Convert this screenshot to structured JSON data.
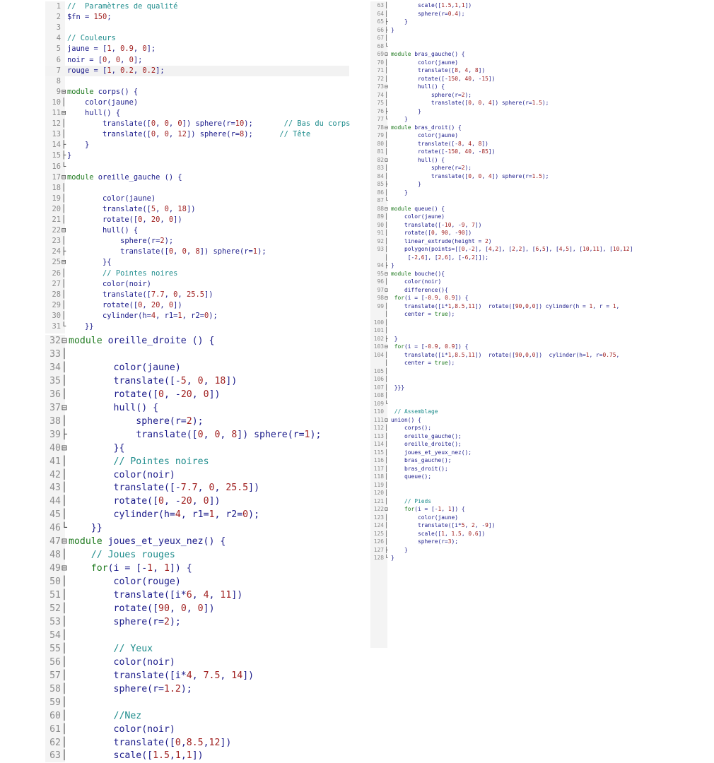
{
  "editor_left": {
    "lines": [
      {
        "n": "1",
        "f": "",
        "t": "//  Paramètres de qualité"
      },
      {
        "n": "2",
        "f": "",
        "t": "$fn = 150;"
      },
      {
        "n": "3",
        "f": "",
        "t": ""
      },
      {
        "n": "4",
        "f": "",
        "t": "// Couleurs"
      },
      {
        "n": "5",
        "f": "",
        "t": "jaune = [1, 0.9, 0];"
      },
      {
        "n": "6",
        "f": "",
        "t": "noir = [0, 0, 0];"
      },
      {
        "n": "7",
        "f": "",
        "t": "rouge = [1, 0.2, 0.2];"
      },
      {
        "n": "8",
        "f": "",
        "t": ""
      },
      {
        "n": "9",
        "f": "⊟",
        "t": "module corps() {"
      },
      {
        "n": "10",
        "f": "│",
        "t": "    color(jaune)"
      },
      {
        "n": "11",
        "f": "⊟",
        "t": "    hull() {"
      },
      {
        "n": "12",
        "f": "│",
        "t": "        translate([0, 0, 0]) sphere(r=10);       // Bas du corps"
      },
      {
        "n": "13",
        "f": "│",
        "t": "        translate([0, 0, 12]) sphere(r=8);      // Tête"
      },
      {
        "n": "14",
        "f": "├",
        "t": "    }"
      },
      {
        "n": "15",
        "f": "├",
        "t": "}"
      },
      {
        "n": "16",
        "f": "└",
        "t": ""
      },
      {
        "n": "17",
        "f": "⊟",
        "t": "module oreille_gauche () {"
      },
      {
        "n": "18",
        "f": "│",
        "t": ""
      },
      {
        "n": "19",
        "f": "│",
        "t": "        color(jaune)"
      },
      {
        "n": "20",
        "f": "│",
        "t": "        translate([5, 0, 18])"
      },
      {
        "n": "21",
        "f": "│",
        "t": "        rotate([0, 20, 0])"
      },
      {
        "n": "22",
        "f": "⊟",
        "t": "        hull() {"
      },
      {
        "n": "23",
        "f": "│",
        "t": "            sphere(r=2);"
      },
      {
        "n": "24",
        "f": "├",
        "t": "            translate([0, 0, 8]) sphere(r=1);"
      },
      {
        "n": "25",
        "f": "⊟",
        "t": "        }{"
      },
      {
        "n": "26",
        "f": "│",
        "t": "        // Pointes noires"
      },
      {
        "n": "27",
        "f": "│",
        "t": "        color(noir)"
      },
      {
        "n": "28",
        "f": "│",
        "t": "        translate([7.7, 0, 25.5])"
      },
      {
        "n": "29",
        "f": "│",
        "t": "        rotate([0, 20, 0])"
      },
      {
        "n": "30",
        "f": "│",
        "t": "        cylinder(h=4, r1=1, r2=0);"
      },
      {
        "n": "31",
        "f": "└",
        "t": "    }}"
      }
    ]
  },
  "editor_left_zoom": {
    "lines": [
      {
        "n": "32",
        "f": "⊟",
        "t": "module oreille_droite () {"
      },
      {
        "n": "33",
        "f": "│",
        "t": ""
      },
      {
        "n": "34",
        "f": "│",
        "t": "        color(jaune)"
      },
      {
        "n": "35",
        "f": "│",
        "t": "        translate([-5, 0, 18])"
      },
      {
        "n": "36",
        "f": "│",
        "t": "        rotate([0, -20, 0])"
      },
      {
        "n": "37",
        "f": "⊟",
        "t": "        hull() {"
      },
      {
        "n": "38",
        "f": "│",
        "t": "            sphere(r=2);"
      },
      {
        "n": "39",
        "f": "├",
        "t": "            translate([0, 0, 8]) sphere(r=1);"
      },
      {
        "n": "40",
        "f": "⊟",
        "t": "        }{"
      },
      {
        "n": "41",
        "f": "│",
        "t": "        // Pointes noires"
      },
      {
        "n": "42",
        "f": "│",
        "t": "        color(noir)"
      },
      {
        "n": "43",
        "f": "│",
        "t": "        translate([-7.7, 0, 25.5])"
      },
      {
        "n": "44",
        "f": "│",
        "t": "        rotate([0, -20, 0])"
      },
      {
        "n": "45",
        "f": "│",
        "t": "        cylinder(h=4, r1=1, r2=0);"
      },
      {
        "n": "46",
        "f": "└",
        "t": "    }}"
      },
      {
        "n": "47",
        "f": "⊟",
        "t": "module joues_et_yeux_nez() {"
      },
      {
        "n": "48",
        "f": "│",
        "t": "    // Joues rouges"
      },
      {
        "n": "49",
        "f": "⊟",
        "t": "    for(i = [-1, 1]) {"
      },
      {
        "n": "50",
        "f": "│",
        "t": "        color(rouge)"
      },
      {
        "n": "51",
        "f": "│",
        "t": "        translate([i*6, 4, 11])"
      },
      {
        "n": "52",
        "f": "│",
        "t": "        rotate([90, 0, 0])"
      },
      {
        "n": "53",
        "f": "│",
        "t": "        sphere(r=2);"
      },
      {
        "n": "54",
        "f": "│",
        "t": ""
      },
      {
        "n": "55",
        "f": "│",
        "t": "        // Yeux"
      },
      {
        "n": "56",
        "f": "│",
        "t": "        color(noir)"
      },
      {
        "n": "57",
        "f": "│",
        "t": "        translate([i*4, 7.5, 14])"
      },
      {
        "n": "58",
        "f": "│",
        "t": "        sphere(r=1.2);"
      },
      {
        "n": "59",
        "f": "│",
        "t": ""
      },
      {
        "n": "60",
        "f": "│",
        "t": "        //Nez"
      },
      {
        "n": "61",
        "f": "│",
        "t": "        color(noir)"
      },
      {
        "n": "62",
        "f": "│",
        "t": "        translate([0,8.5,12])"
      },
      {
        "n": "63",
        "f": "│",
        "t": "        scale([1.5,1,1])"
      }
    ]
  },
  "editor_right": {
    "lines": [
      {
        "n": "63",
        "f": "│",
        "t": "        scale([1.5,1,1])"
      },
      {
        "n": "64",
        "f": "│",
        "t": "        sphere(r=0.4);"
      },
      {
        "n": "65",
        "f": "├",
        "t": "    }"
      },
      {
        "n": "66",
        "f": "├",
        "t": "}"
      },
      {
        "n": "67",
        "f": "│",
        "t": ""
      },
      {
        "n": "68",
        "f": "└",
        "t": ""
      },
      {
        "n": "69",
        "f": "⊟",
        "t": "module bras_gauche() {"
      },
      {
        "n": "70",
        "f": "│",
        "t": "        color(jaune)"
      },
      {
        "n": "71",
        "f": "│",
        "t": "        translate([8, 4, 8])"
      },
      {
        "n": "72",
        "f": "│",
        "t": "        rotate([-150, 40, -15])"
      },
      {
        "n": "73",
        "f": "⊟",
        "t": "        hull() {"
      },
      {
        "n": "74",
        "f": "│",
        "t": "            sphere(r=2);"
      },
      {
        "n": "75",
        "f": "│",
        "t": "            translate([0, 0, 4]) sphere(r=1.5);"
      },
      {
        "n": "76",
        "f": "├",
        "t": "        }"
      },
      {
        "n": "77",
        "f": "└",
        "t": "    }"
      },
      {
        "n": "78",
        "f": "⊟",
        "t": "module bras_droit() {"
      },
      {
        "n": "79",
        "f": "│",
        "t": "        color(jaune)"
      },
      {
        "n": "80",
        "f": "│",
        "t": "        translate([-8, 4, 8])"
      },
      {
        "n": "81",
        "f": "│",
        "t": "        rotate([-150, 40, -85])"
      },
      {
        "n": "82",
        "f": "⊟",
        "t": "        hull() {"
      },
      {
        "n": "83",
        "f": "│",
        "t": "            sphere(r=2);"
      },
      {
        "n": "84",
        "f": "│",
        "t": "            translate([0, 0, 4]) sphere(r=1.5);"
      },
      {
        "n": "85",
        "f": "├",
        "t": "        }"
      },
      {
        "n": "86",
        "f": "│",
        "t": "    }"
      },
      {
        "n": "87",
        "f": "└",
        "t": ""
      },
      {
        "n": "88",
        "f": "⊟",
        "t": "module queue() {"
      },
      {
        "n": "89",
        "f": "│",
        "t": "    color(jaune)"
      },
      {
        "n": "90",
        "f": "│",
        "t": "    translate([-10, -9, 7])"
      },
      {
        "n": "91",
        "f": "│",
        "t": "    rotate([0, 90, -90])"
      },
      {
        "n": "92",
        "f": "│",
        "t": "    linear_extrude(height = 2)"
      },
      {
        "n": "93",
        "f": "│",
        "t": "    polygon(points=[[0,-2], [4,2], [2,2], [6,5], [4,5], [10,11], [10,12]"
      },
      {
        "n": "",
        "f": "│",
        "t": "     [-2,6], [2,6], [-6,2]]);"
      },
      {
        "n": "94",
        "f": "├",
        "t": "}"
      },
      {
        "n": "95",
        "f": "⊟",
        "t": "module bouche(){"
      },
      {
        "n": "96",
        "f": "│",
        "t": "    color(noir)"
      },
      {
        "n": "97",
        "f": "⊟",
        "t": "    difference(){"
      },
      {
        "n": "98",
        "f": "⊟",
        "t": " for(i = [-0.9, 0.9]) {"
      },
      {
        "n": "99",
        "f": "│",
        "t": "    translate([i*1,8.5,11])  rotate([90,0,0]) cylinder(h = 1, r = 1,"
      },
      {
        "n": "",
        "f": "│",
        "t": "    center = true);"
      },
      {
        "n": "100",
        "f": "│",
        "t": ""
      },
      {
        "n": "101",
        "f": "│",
        "t": ""
      },
      {
        "n": "102",
        "f": "├",
        "t": " }"
      },
      {
        "n": "103",
        "f": "⊟",
        "t": " for(i = [-0.9, 0.9]) {"
      },
      {
        "n": "104",
        "f": "│",
        "t": "    translate([i*1,8.5,11])  rotate([90,0,0])  cylinder(h=1, r=0.75,"
      },
      {
        "n": "",
        "f": "│",
        "t": "    center = true);"
      },
      {
        "n": "105",
        "f": "│",
        "t": ""
      },
      {
        "n": "106",
        "f": "│",
        "t": ""
      },
      {
        "n": "107",
        "f": "│",
        "t": " }}}"
      },
      {
        "n": "108",
        "f": "│",
        "t": ""
      },
      {
        "n": "109",
        "f": "└",
        "t": ""
      },
      {
        "n": "110",
        "f": "",
        "t": " // Assemblage"
      },
      {
        "n": "111",
        "f": "⊟",
        "t": "union() {"
      },
      {
        "n": "112",
        "f": "│",
        "t": "    corps();"
      },
      {
        "n": "113",
        "f": "│",
        "t": "    oreille_gauche();"
      },
      {
        "n": "114",
        "f": "│",
        "t": "    oreille_droite();"
      },
      {
        "n": "115",
        "f": "│",
        "t": "    joues_et_yeux_nez();"
      },
      {
        "n": "116",
        "f": "│",
        "t": "    bras_gauche();"
      },
      {
        "n": "117",
        "f": "│",
        "t": "    bras_droit();"
      },
      {
        "n": "118",
        "f": "│",
        "t": "    queue();"
      },
      {
        "n": "119",
        "f": "│",
        "t": ""
      },
      {
        "n": "120",
        "f": "│",
        "t": ""
      },
      {
        "n": "121",
        "f": "│",
        "t": "    // Pieds"
      },
      {
        "n": "122",
        "f": "⊟",
        "t": "    for(i = [-1, 1]) {"
      },
      {
        "n": "123",
        "f": "│",
        "t": "        color(jaune)"
      },
      {
        "n": "124",
        "f": "│",
        "t": "        translate([i*5, 2, -9])"
      },
      {
        "n": "125",
        "f": "│",
        "t": "        scale([1, 1.5, 0.6])"
      },
      {
        "n": "126",
        "f": "│",
        "t": "        sphere(r=3);"
      },
      {
        "n": "127",
        "f": "├",
        "t": "    }"
      },
      {
        "n": "128",
        "f": "└",
        "t": "}"
      }
    ]
  }
}
